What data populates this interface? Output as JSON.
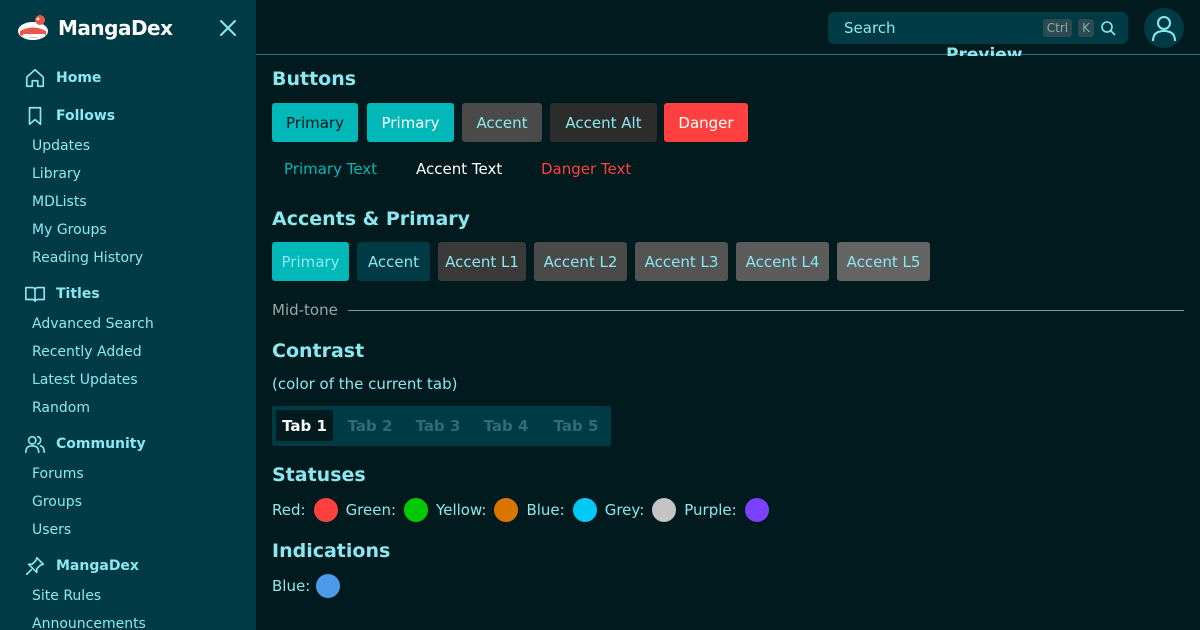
{
  "brand": {
    "name": "MangaDex"
  },
  "sidebar": {
    "sections": [
      {
        "label": "Home",
        "icon": "home-icon",
        "items": []
      },
      {
        "label": "Follows",
        "icon": "bookmark-icon",
        "items": [
          "Updates",
          "Library",
          "MDLists",
          "My Groups",
          "Reading History"
        ]
      },
      {
        "label": "Titles",
        "icon": "book-icon",
        "items": [
          "Advanced Search",
          "Recently Added",
          "Latest Updates",
          "Random"
        ]
      },
      {
        "label": "Community",
        "icon": "users-icon",
        "items": [
          "Forums",
          "Groups",
          "Users"
        ]
      },
      {
        "label": "MangaDex",
        "icon": "pin-icon",
        "items": [
          "Site Rules",
          "Announcements"
        ]
      }
    ]
  },
  "header": {
    "search_placeholder": "Search",
    "shortcut_ctrl": "Ctrl",
    "shortcut_key": "K",
    "preview_title": "Preview"
  },
  "buttons_section": {
    "title": "Buttons",
    "buttons": [
      "Primary",
      "Primary",
      "Accent",
      "Accent Alt",
      "Danger"
    ],
    "text_buttons": [
      "Primary Text",
      "Accent Text",
      "Danger Text"
    ]
  },
  "accents_section": {
    "title": "Accents & Primary",
    "swatches": [
      "Primary",
      "Accent",
      "Accent L1",
      "Accent L2",
      "Accent L3",
      "Accent L4",
      "Accent L5"
    ]
  },
  "midtone_label": "Mid-tone",
  "contrast_section": {
    "title": "Contrast",
    "subtitle": "(color of the current tab)",
    "tabs": [
      "Tab 1",
      "Tab 2",
      "Tab 3",
      "Tab 4",
      "Tab 5"
    ],
    "active_tab": "Tab 1"
  },
  "statuses_section": {
    "title": "Statuses",
    "items": [
      {
        "label": "Red:",
        "color": "#ff4040"
      },
      {
        "label": "Green:",
        "color": "#00c900"
      },
      {
        "label": "Yellow:",
        "color": "#da7500"
      },
      {
        "label": "Blue:",
        "color": "#00c9f5"
      },
      {
        "label": "Grey:",
        "color": "#c4c4c4"
      },
      {
        "label": "Purple:",
        "color": "#7c40ff"
      }
    ]
  },
  "indications_section": {
    "title": "Indications",
    "items": [
      {
        "label": "Blue:",
        "color": "#4c9be8"
      }
    ]
  },
  "colors": {
    "primary": "#00b8b8",
    "accent": "#003a45",
    "danger": "#ff4040",
    "background": "#001a1d"
  }
}
